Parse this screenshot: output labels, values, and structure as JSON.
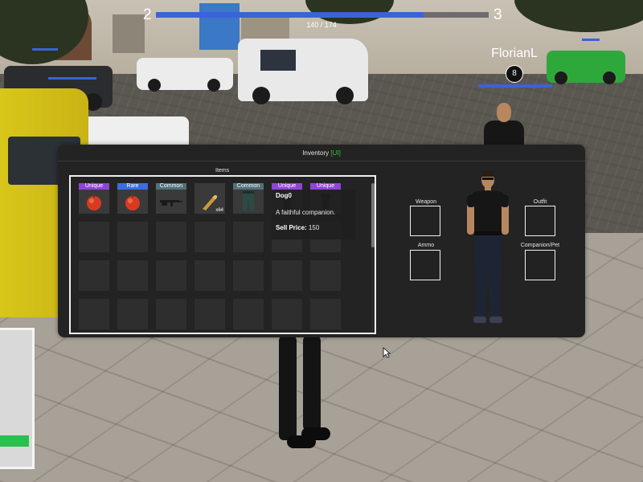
{
  "hud": {
    "left_value": "2",
    "right_value": "3",
    "progress_text": "140 / 174",
    "progress_fraction": 0.805,
    "player_name": "FlorianL",
    "player_level": "8",
    "accent": "#3b63d8"
  },
  "inventory": {
    "title": "Inventory",
    "title_tag": "[UI]",
    "items_label": "Items",
    "items": [
      {
        "rarity": "Unique",
        "icon": "apple-icon",
        "qty": ""
      },
      {
        "rarity": "Rare",
        "icon": "apple-icon",
        "qty": ""
      },
      {
        "rarity": "Common",
        "icon": "rifle-icon",
        "qty": ""
      },
      {
        "rarity": "",
        "icon": "ammo-round-icon",
        "qty": "x64"
      },
      {
        "rarity": "Common",
        "icon": "pants-icon",
        "qty": ""
      },
      {
        "rarity": "Unique",
        "icon": "dog-icon",
        "qty": ""
      },
      {
        "rarity": "Unique",
        "icon": "dog-icon",
        "qty": ""
      }
    ],
    "tooltip": {
      "name": "Dog0",
      "description": "A faithful companion.",
      "sell_label": "Sell Price:",
      "sell_value": "150"
    },
    "equipment": {
      "weapon": "Weapon",
      "outfit": "Outfit",
      "ammo": "Ammo",
      "companion": "Companion/Pet"
    }
  },
  "colors": {
    "unique": "#8e44d8",
    "rare": "#3c6de0",
    "common": "#52707a",
    "ui_tag": "#32c832"
  }
}
